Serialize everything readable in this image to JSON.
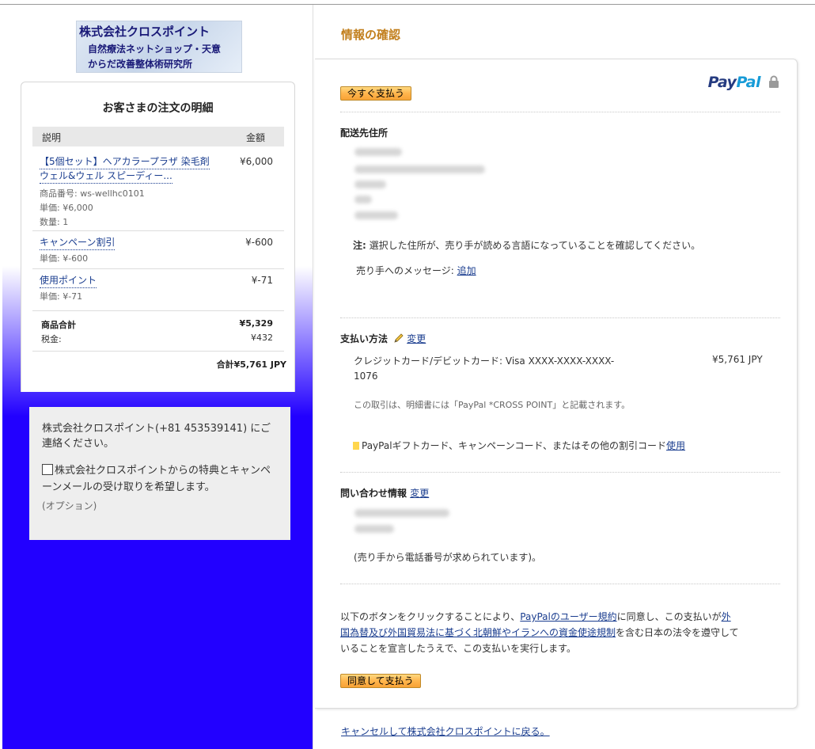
{
  "merchant": {
    "logo_line1": "株式会社クロスポイント",
    "logo_line2": "自然療法ネットショップ・天意",
    "logo_line3": "からだ改善整体術研究所"
  },
  "order": {
    "title": "お客さまの注文の明細",
    "col_desc": "説明",
    "col_amount": "金額",
    "items": [
      {
        "name_line1": "【5個セット】ヘアカラープラザ 染毛剤",
        "name_line2": "ウェル&ウェル スピーディー...",
        "item_no": "商品番号: ws-wellhc0101",
        "unit_price": "単価: ¥6,000",
        "quantity": "数量: 1",
        "amount": "¥6,000"
      },
      {
        "name_line1": "キャンペーン割引",
        "unit_price": "単価: ¥-600",
        "amount": "¥-600"
      },
      {
        "name_line1": "使用ポイント",
        "unit_price": "単価: ¥-71",
        "amount": "¥-71"
      }
    ],
    "subtotal_label": "商品合計",
    "subtotal_value": "¥5,329",
    "tax_label": "税金:",
    "tax_value": "¥432",
    "grand_total": "合計¥5,761 JPY"
  },
  "contact_box": {
    "text": "株式会社クロスポイント(+81 453539141) にご連絡ください。",
    "optin_label": "株式会社クロスポイントからの特典とキャンペーンメールの受け取りを希望します。",
    "optional": "(オプション)"
  },
  "main": {
    "page_title": "情報の確認",
    "paypal_logo_pay": "Pay",
    "paypal_logo_pal": "Pal",
    "pay_now_button": "今すぐ支払う",
    "shipping_heading": "配送先住所",
    "address_note_bold": "注:",
    "address_note": " 選択した住所が、売り手が読める言語になっていることを確認してください。",
    "message_label": "売り手へのメッセージ: ",
    "message_link": "追加",
    "payment_heading": "支払い方法",
    "payment_change": "変更",
    "card_line1": "クレジットカード/デビットカード: Visa XXXX-XXXX-XXXX-",
    "card_line2": "1076",
    "card_amount": "¥5,761 JPY",
    "statement_note": "この取引は、明細書には「PayPal *CROSS POINT」と記載されます。",
    "gift_text": "PayPalギフトカード、キャンペーンコード、またはその他の割引コード",
    "gift_link": "使用",
    "contact_heading": "問い合わせ情報",
    "contact_change": "変更",
    "phone_note": "(売り手から電話番号が求められています)。",
    "agree_text1": "以下のボタンをクリックすることにより、",
    "agree_link1": "PayPalのユーザー規約",
    "agree_text2": "に同意し、この支払いが",
    "agree_link2a": "外",
    "agree_link2b": "国為替及び外国貿易法に基づく北朝鮮やイランへの資金使途規制",
    "agree_text3": "を含む日本の法令を遵守して",
    "agree_text4": "いることを宣言したうえで、この支払いを実行します。",
    "agree_button": "同意して支払う"
  },
  "cancel_link": "キャンセルして株式会社クロスポイントに戻る。",
  "colors": {
    "title_orange": "#c27f1d",
    "link_blue": "#1a3d8f",
    "sidebar_blue": "#2200ff",
    "paypal_dark": "#253b80",
    "paypal_light": "#179bd7"
  }
}
